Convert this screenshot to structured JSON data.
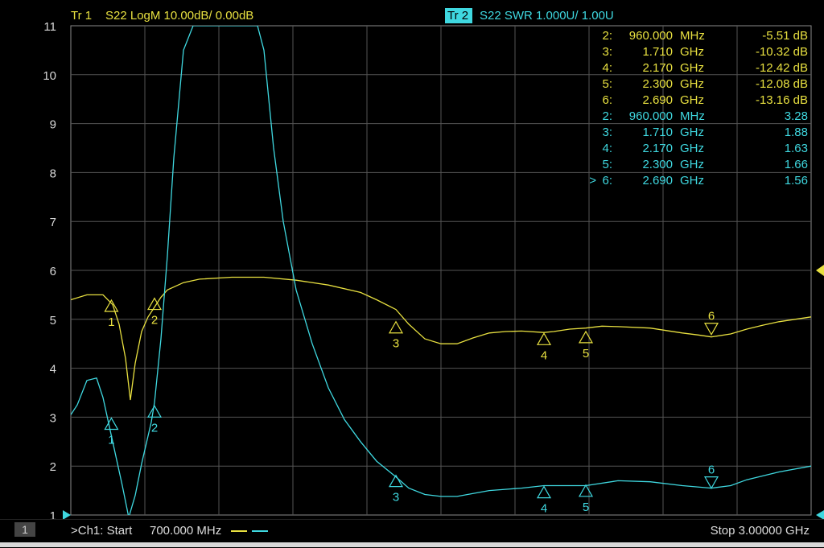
{
  "trace1": {
    "label": "Tr 1",
    "params": "S22 LogM 10.00dB/  0.00dB",
    "color": "#e8e040"
  },
  "trace2": {
    "label": "Tr 2",
    "params": "S22 SWR 1.000U/  1.00U",
    "color": "#3fd8e0"
  },
  "marker_table": [
    {
      "trace": 1,
      "prefix": "",
      "id": "2:",
      "freq": "960.000",
      "unit": "MHz",
      "value": "-5.51 dB"
    },
    {
      "trace": 1,
      "prefix": "",
      "id": "3:",
      "freq": "1.710",
      "unit": "GHz",
      "value": "-10.32 dB"
    },
    {
      "trace": 1,
      "prefix": "",
      "id": "4:",
      "freq": "2.170",
      "unit": "GHz",
      "value": "-12.42 dB"
    },
    {
      "trace": 1,
      "prefix": "",
      "id": "5:",
      "freq": "2.300",
      "unit": "GHz",
      "value": "-12.08 dB"
    },
    {
      "trace": 1,
      "prefix": "",
      "id": "6:",
      "freq": "2.690",
      "unit": "GHz",
      "value": "-13.16 dB"
    },
    {
      "trace": 2,
      "prefix": "",
      "id": "2:",
      "freq": "960.000",
      "unit": "MHz",
      "value": "3.28"
    },
    {
      "trace": 2,
      "prefix": "",
      "id": "3:",
      "freq": "1.710",
      "unit": "GHz",
      "value": "1.88"
    },
    {
      "trace": 2,
      "prefix": "",
      "id": "4:",
      "freq": "2.170",
      "unit": "GHz",
      "value": "1.63"
    },
    {
      "trace": 2,
      "prefix": "",
      "id": "5:",
      "freq": "2.300",
      "unit": "GHz",
      "value": "1.66"
    },
    {
      "trace": 2,
      "prefix": ">",
      "id": "6:",
      "freq": "2.690",
      "unit": "GHz",
      "value": "1.56"
    }
  ],
  "footer": {
    "channel_badge": "1",
    "start_label": ">Ch1:  Start",
    "start_value": "700.000 MHz",
    "stop": "Stop  3.00000 GHz"
  },
  "chart_data": {
    "type": "line",
    "x_unit": "GHz",
    "xlim": [
      0.7,
      3.0
    ],
    "ylim": [
      1,
      11
    ],
    "y_ticks": [
      "1",
      "2",
      "3",
      "4",
      "5",
      "6",
      "7",
      "8",
      "9",
      "10",
      "11"
    ],
    "grid": true,
    "series": [
      {
        "color": "#e8e040",
        "x": [
          0.7,
          0.75,
          0.8,
          0.83,
          0.85,
          0.87,
          0.885,
          0.9,
          0.92,
          0.94,
          0.96,
          0.98,
          1.0,
          1.05,
          1.1,
          1.2,
          1.3,
          1.4,
          1.5,
          1.6,
          1.65,
          1.71,
          1.75,
          1.8,
          1.85,
          1.9,
          1.95,
          2.0,
          2.05,
          2.1,
          2.17,
          2.2,
          2.25,
          2.3,
          2.35,
          2.4,
          2.5,
          2.6,
          2.65,
          2.69,
          2.75,
          2.8,
          2.85,
          2.9,
          2.95,
          3.0
        ],
        "y": [
          5.4,
          5.5,
          5.5,
          5.3,
          4.9,
          4.2,
          3.35,
          4.1,
          4.75,
          5.05,
          5.25,
          5.45,
          5.6,
          5.75,
          5.82,
          5.86,
          5.86,
          5.8,
          5.7,
          5.55,
          5.4,
          5.2,
          4.9,
          4.6,
          4.5,
          4.5,
          4.62,
          4.72,
          4.75,
          4.76,
          4.73,
          4.75,
          4.8,
          4.82,
          4.86,
          4.85,
          4.82,
          4.72,
          4.68,
          4.64,
          4.7,
          4.8,
          4.88,
          4.95,
          5.0,
          5.05
        ]
      },
      {
        "color": "#3fd8e0",
        "x": [
          0.7,
          0.72,
          0.75,
          0.78,
          0.8,
          0.83,
          0.86,
          0.88,
          0.9,
          0.92,
          0.95,
          0.96,
          0.98,
          1.0,
          1.02,
          1.05,
          1.08,
          1.1,
          1.15,
          1.2,
          1.25,
          1.28,
          1.3,
          1.33,
          1.36,
          1.4,
          1.45,
          1.5,
          1.55,
          1.6,
          1.65,
          1.71,
          1.75,
          1.8,
          1.85,
          1.9,
          2.0,
          2.1,
          2.17,
          2.2,
          2.3,
          2.4,
          2.5,
          2.6,
          2.69,
          2.75,
          2.8,
          2.9,
          3.0
        ],
        "y": [
          3.05,
          3.25,
          3.75,
          3.8,
          3.4,
          2.5,
          1.6,
          0.95,
          1.4,
          2.05,
          2.9,
          3.3,
          4.6,
          6.3,
          8.3,
          10.5,
          11.0,
          11.0,
          11.0,
          11.0,
          11.0,
          11.0,
          10.5,
          8.5,
          7.0,
          5.6,
          4.5,
          3.6,
          2.95,
          2.5,
          2.1,
          1.78,
          1.55,
          1.42,
          1.38,
          1.38,
          1.5,
          1.55,
          1.6,
          1.6,
          1.6,
          1.7,
          1.68,
          1.6,
          1.55,
          1.6,
          1.72,
          1.88,
          2.0
        ]
      }
    ],
    "markers": [
      {
        "trace": 1,
        "label": "1",
        "x": 0.826,
        "y": 5.26,
        "dir": "up"
      },
      {
        "trace": 1,
        "label": "2",
        "x": 0.96,
        "y": 5.3,
        "dir": "up"
      },
      {
        "trace": 1,
        "label": "3",
        "x": 1.71,
        "y": 4.82,
        "dir": "up"
      },
      {
        "trace": 1,
        "label": "4",
        "x": 2.17,
        "y": 4.58,
        "dir": "up"
      },
      {
        "trace": 1,
        "label": "5",
        "x": 2.3,
        "y": 4.62,
        "dir": "up"
      },
      {
        "trace": 1,
        "label": "6",
        "x": 2.69,
        "y": 4.82,
        "dir": "down"
      },
      {
        "trace": 2,
        "label": "1",
        "x": 0.826,
        "y": 2.85,
        "dir": "up"
      },
      {
        "trace": 2,
        "label": "2",
        "x": 0.96,
        "y": 3.1,
        "dir": "up"
      },
      {
        "trace": 2,
        "label": "3",
        "x": 1.71,
        "y": 1.68,
        "dir": "up"
      },
      {
        "trace": 2,
        "label": "4",
        "x": 2.17,
        "y": 1.45,
        "dir": "up"
      },
      {
        "trace": 2,
        "label": "5",
        "x": 2.3,
        "y": 1.48,
        "dir": "up"
      },
      {
        "trace": 2,
        "label": "6",
        "x": 2.69,
        "y": 1.68,
        "dir": "down"
      }
    ]
  }
}
